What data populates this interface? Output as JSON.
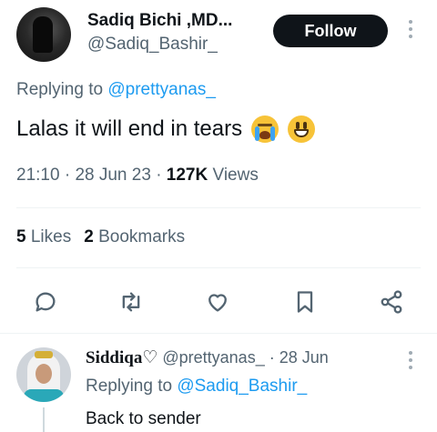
{
  "tweet": {
    "display_name": "Sadiq Bichi ,MD...",
    "handle": "@Sadiq_Bashir_",
    "follow_label": "Follow",
    "replying_prefix": "Replying to ",
    "replying_to": "@prettyanas_",
    "text": "Lalas it will end in tears",
    "emojis": [
      "loudly-crying-face",
      "grinning-face"
    ],
    "time": "21:10",
    "date": "28 Jun 23",
    "views_count": "127K",
    "views_label": "Views",
    "likes_count": "5",
    "likes_label": "Likes",
    "bookmarks_count": "2",
    "bookmarks_label": "Bookmarks"
  },
  "actions": [
    {
      "name": "reply",
      "icon": "reply-icon"
    },
    {
      "name": "retweet",
      "icon": "retweet-icon"
    },
    {
      "name": "like",
      "icon": "heart-icon"
    },
    {
      "name": "bookmark",
      "icon": "bookmark-icon"
    },
    {
      "name": "share",
      "icon": "share-icon"
    }
  ],
  "reply": {
    "display_name": "Siddiqa♡",
    "handle": "@prettyanas_",
    "separator": "·",
    "date": "28 Jun",
    "replying_prefix": "Replying to ",
    "replying_to": "@Sadiq_Bashir_",
    "text": "Back to sender"
  },
  "colors": {
    "accent": "#1d9bf0",
    "text": "#0f1419",
    "secondary": "#536471",
    "divider": "#eff3f4",
    "follow_bg": "#0f1419"
  }
}
